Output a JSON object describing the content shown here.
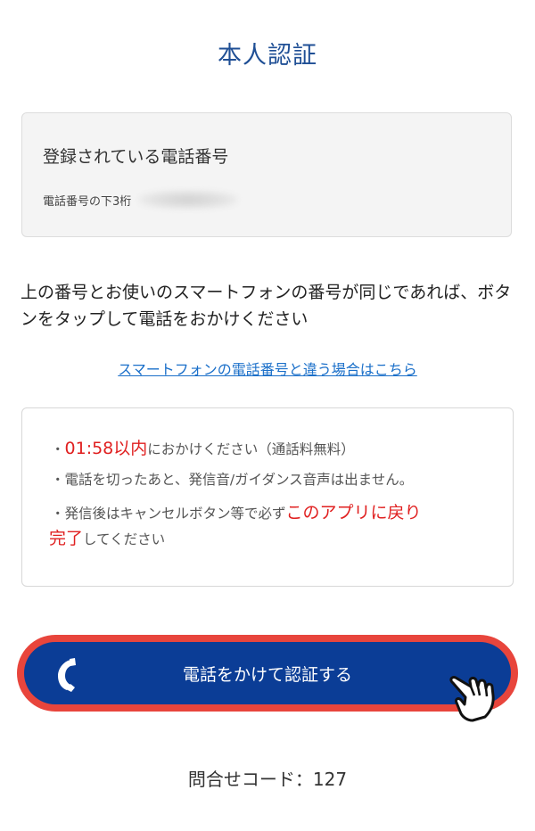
{
  "header": {
    "title": "本人認証"
  },
  "registered_phone": {
    "title": "登録されている電話番号",
    "last_digits_label": "電話番号の下3桁"
  },
  "instruction": "上の番号とお使いのスマートフォンの番号が同じであれば、ボタンをタップして電話をおかけください",
  "different_number_link": "スマートフォンの電話番号と違う場合はこちら",
  "notice": {
    "line1_bullet": "・",
    "line1_time": "01:58以内",
    "line1_rest": "におかけください（通話料無料）",
    "line2": "・電話を切ったあと、発信音/ガイダンス音声は出ません。",
    "line3_prefix": "・発信後はキャンセルボタン等で必ず",
    "line3_red": "このアプリに戻り",
    "line4_red": "完了",
    "line4_rest": "してください"
  },
  "call_button": {
    "label": "電話をかけて認証する"
  },
  "inquiry_code": "問合せコード：127",
  "icons": {
    "phone": "phone-handset-icon",
    "hand": "pointing-hand-icon"
  },
  "colors": {
    "title": "#1f4f95",
    "button": "#0b3d96",
    "outline": "#e8453c",
    "alert": "#e02020",
    "link": "#1a6fc9"
  }
}
